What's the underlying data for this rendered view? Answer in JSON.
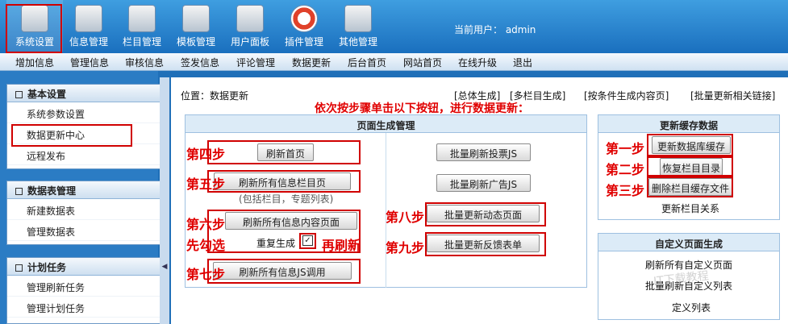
{
  "toolbar": {
    "items": [
      {
        "label": "系统设置",
        "icon": "wrench-icon"
      },
      {
        "label": "信息管理",
        "icon": "documents-icon"
      },
      {
        "label": "栏目管理",
        "icon": "folder-icon"
      },
      {
        "label": "模板管理",
        "icon": "template-icon"
      },
      {
        "label": "用户面板",
        "icon": "users-icon"
      },
      {
        "label": "插件管理",
        "icon": "lifebuoy-icon"
      },
      {
        "label": "其他管理",
        "icon": "page-play-icon"
      }
    ],
    "current_user": "当前用户： admin"
  },
  "menubar": [
    "增加信息",
    "管理信息",
    "审核信息",
    "签发信息",
    "评论管理",
    "数据更新",
    "后台首页",
    "网站首页",
    "在线升级",
    "退出"
  ],
  "sidebar": {
    "sections": [
      {
        "title": "基本设置",
        "items": [
          "系统参数设置",
          "数据更新中心",
          "远程发布"
        ]
      },
      {
        "title": "数据表管理",
        "items": [
          "新建数据表",
          "管理数据表"
        ]
      },
      {
        "title": "计划任务",
        "items": [
          "管理刷新任务",
          "管理计划任务"
        ]
      }
    ]
  },
  "main": {
    "location": "位置：数据更新",
    "top_links": [
      "[总体生成]",
      "[多栏目生成]",
      "[按条件生成内容页]",
      "[批量更新相关链接]"
    ],
    "instruction": "依次按步骤单击以下按钮，进行数据更新：",
    "page_gen": {
      "title": "页面生成管理",
      "buttons_left": [
        "刷新首页",
        "刷新所有信息栏目页",
        "刷新所有信息内容页面",
        "刷新所有信息JS调用"
      ],
      "note": "(包括栏目，专题列表)",
      "checkbox_label": "重复生成",
      "checkbox_checked": "✓",
      "buttons_right": [
        "批量刷新投票JS",
        "批量刷新广告JS",
        "批量更新动态页面",
        "批量更新反馈表单"
      ]
    },
    "cache": {
      "title": "更新缓存数据",
      "buttons": [
        "更新数据库缓存",
        "恢复栏目目录",
        "删除栏目缓存文件"
      ],
      "link": "更新栏目关系"
    },
    "custom": {
      "title": "自定义页面生成",
      "links": [
        "刷新所有自定义页面",
        "批量刷新自定义列表",
        "定义列表"
      ],
      "watermark": "IT下载教程"
    },
    "steps": {
      "s4": "第四步",
      "s5": "第五步",
      "s6": "第六步",
      "s7": "第七步",
      "s8": "第八步",
      "s9": "第九步",
      "s1": "第一步",
      "s2": "第二步",
      "s3": "第三步",
      "check_first": "先勾选",
      "then_refresh": "再刷新"
    }
  }
}
